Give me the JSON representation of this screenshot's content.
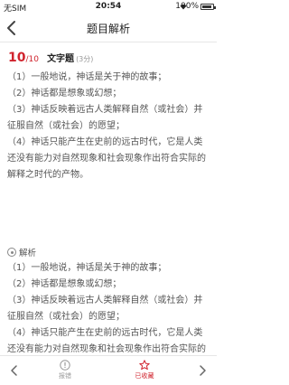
{
  "status": {
    "carrier": "无SIM",
    "time": "20:54",
    "battery": "100%"
  },
  "nav": {
    "title": "题目解析"
  },
  "question": {
    "number": "10",
    "total": "/10",
    "type": "文字题",
    "score": "(3分)"
  },
  "answer_text": "（1）一般地说，神话是关于神的故事；\n（2）神话都是想象或幻想；\n（3）神话反映着远古人类解释自然（或社会）并征服自然（或社会）的愿望；\n（4）神话只能产生在史前的远古时代，它是人类还没有能力对自然现象和社会现象作出符合实际的解释之时代的产物。",
  "analysis": {
    "title": "解析",
    "text": "（1）一般地说，神话是关于神的故事；\n（2）神话都是想象或幻想；\n（3）神话反映着远古人类解释自然（或社会）并征服自然（或社会）的愿望；\n（4）神话只能产生在史前的远古时代，它是人类还没有能力对自然现象和社会现象作出符合实际的解释之时代的产物。"
  },
  "bottom": {
    "report_label": "报错",
    "favorite_label": "已收藏"
  },
  "colors": {
    "accent": "#d0232d",
    "muted": "#999999"
  }
}
